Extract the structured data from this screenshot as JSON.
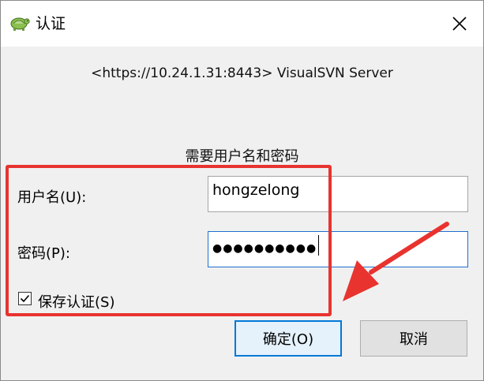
{
  "window": {
    "title": "认证",
    "close_icon": "close-icon",
    "app_icon": "tortoise-icon"
  },
  "server": {
    "text": "<https://10.24.1.31:8443> VisualSVN Server"
  },
  "prompt": {
    "text": "需要用户名和密码"
  },
  "form": {
    "username_label": "用户名(U):",
    "username_value": "hongzelong",
    "password_label": "密码(P):",
    "password_value": "●●●●●●●●●●",
    "save_label": "保存认证(S)",
    "save_checked": true
  },
  "buttons": {
    "ok_label": "确定(O)",
    "cancel_label": "取消"
  },
  "annotation": {
    "color": "#e8332f"
  }
}
